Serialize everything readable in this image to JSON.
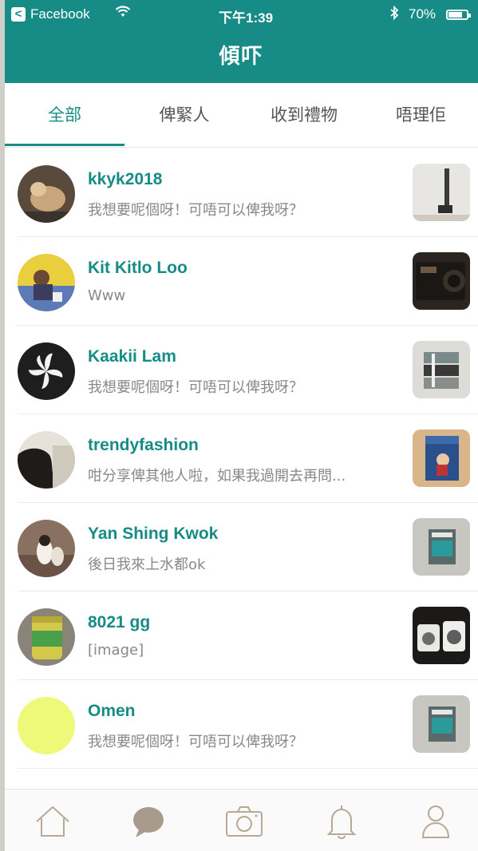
{
  "status_bar": {
    "carrier": "Facebook",
    "time": "下午1:39",
    "battery": "70%",
    "back_badge": "<"
  },
  "header": {
    "title": "傾吓"
  },
  "tabs": [
    {
      "label": "全部",
      "active": true
    },
    {
      "label": "俾緊人",
      "active": false
    },
    {
      "label": "收到禮物",
      "active": false
    },
    {
      "label": "唔理佢",
      "active": false
    }
  ],
  "conversations": [
    {
      "name": "kkyk2018",
      "message": "我想要呢個呀！可唔可以俾我呀？"
    },
    {
      "name": "Kit Kitlo Loo",
      "message": "Www"
    },
    {
      "name": "Kaakii Lam",
      "message": "我想要呢個呀！可唔可以俾我呀？"
    },
    {
      "name": "trendyfashion",
      "message": "咁分享俾其他人啦，如果我過開去再問..."
    },
    {
      "name": "Yan Shing Kwok",
      "message": "後日我來上水都ok"
    },
    {
      "name": "8021 gg",
      "message": "[image]"
    },
    {
      "name": "Omen",
      "message": "我想要呢個呀！可唔可以俾我呀？"
    }
  ],
  "bottom_nav": [
    {
      "icon": "home-icon"
    },
    {
      "icon": "chat-icon",
      "active": true
    },
    {
      "icon": "camera-icon"
    },
    {
      "icon": "bell-icon"
    },
    {
      "icon": "profile-icon"
    }
  ],
  "colors": {
    "brand": "#178b86",
    "active_chat": "#a89b8c",
    "nav_icon": "#b8a996"
  }
}
